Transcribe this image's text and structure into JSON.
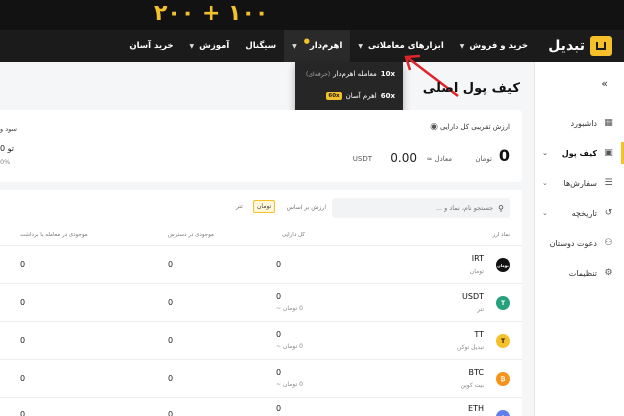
{
  "banner": {
    "text": "۲۰۰ + ۱۰۰"
  },
  "navbar": {
    "logo_text": "تبدیل",
    "items": [
      {
        "label": "خرید و فروش",
        "has_dropdown": true
      },
      {
        "label": "ابزارهای معاملاتی",
        "has_dropdown": true
      },
      {
        "label": "اهرم‌دار",
        "has_dropdown": true
      },
      {
        "label": "سیگنال",
        "has_dropdown": false
      },
      {
        "label": "آموزش",
        "has_dropdown": true
      },
      {
        "label": "خرید آسان",
        "has_dropdown": false
      }
    ]
  },
  "dropdown": {
    "item1": {
      "leverage": "10x",
      "label": "معامله اهرم‌دار",
      "sub": "(حرفه‌ای)"
    },
    "item2": {
      "leverage": "60x",
      "label": "اهرم آسان",
      "badge": "60x"
    }
  },
  "sidebar": {
    "items": [
      {
        "label": "داشبورد",
        "icon": "grid-icon"
      },
      {
        "label": "کیف پول",
        "icon": "wallet-icon",
        "active": true
      },
      {
        "label": "سفارش‌ها",
        "icon": "list-icon"
      },
      {
        "label": "تاریخچه",
        "icon": "history-icon"
      },
      {
        "label": "دعوت دوستان",
        "icon": "user-plus-icon"
      },
      {
        "label": "تنظیمات",
        "icon": "gear-icon"
      }
    ]
  },
  "page": {
    "title": "کیف پول اصلی"
  },
  "summary": {
    "estimated_label": "ارزش تقریبی کل دارایی",
    "total_toman": "0",
    "toman_label": "تومان",
    "equiv_label": "معادل ≈",
    "usdt_value": "0.00",
    "usdt_label": "USDT",
    "pl_label": "سود و",
    "pl_value": "0 تو",
    "pl_pct": "0%"
  },
  "assets": {
    "search_placeholder": "جستجو نام، نماد و ...",
    "value_by_label": "ارزش بر اساس",
    "toggle_toman": "تومان",
    "toggle_tether": "تتر",
    "columns": {
      "symbol": "نماد ارز",
      "total": "کل دارایی",
      "available": "موجودی در دسترس",
      "in_trade": "موجودی در معامله یا برداشت"
    },
    "rows": [
      {
        "symbol": "IRT",
        "name": "تومان",
        "total": "0",
        "total_sub": "",
        "available": "0",
        "in_trade": "0",
        "color": "#111111",
        "icon_text": "تومان"
      },
      {
        "symbol": "USDT",
        "name": "تتر",
        "total": "0",
        "total_sub": "0 تومان ~",
        "available": "0",
        "in_trade": "0",
        "color": "#26a17b",
        "icon_text": "T"
      },
      {
        "symbol": "TT",
        "name": "تبدیل توکن",
        "total": "0",
        "total_sub": "0 تومان ~",
        "available": "0",
        "in_trade": "0",
        "color": "#f6c02b",
        "icon_text": "T"
      },
      {
        "symbol": "BTC",
        "name": "بیت کوین",
        "total": "0",
        "total_sub": "0 تومان ~",
        "available": "0",
        "in_trade": "0",
        "color": "#f7931a",
        "icon_text": "₿"
      },
      {
        "symbol": "ETH",
        "name": "",
        "total": "0",
        "total_sub": "",
        "available": "0",
        "in_trade": "0",
        "color": "#627eea",
        "icon_text": "◆"
      }
    ]
  }
}
